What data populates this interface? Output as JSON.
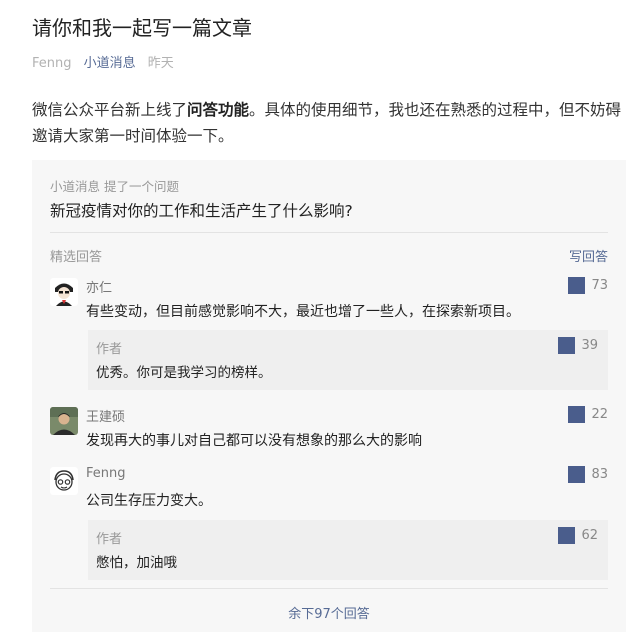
{
  "article": {
    "title": "请你和我一起写一篇文章",
    "author": "Fenng",
    "source": "小道消息",
    "time": "昨天",
    "intro_before": "微信公众平台新上线了",
    "intro_bold": "问答功能",
    "intro_after": "。具体的使用细节，我也还在熟悉的过程中，但不妨碍邀请大家第一时间体验一下。"
  },
  "qa": {
    "asker": "小道消息",
    "ask_action": "提了一个问题",
    "question": "新冠疫情对你的工作和生活产生了什么影响?",
    "featured_label": "精选回答",
    "write_label": "写回答",
    "answers": [
      {
        "name": "亦仁",
        "text": "有些变动，但目前感觉影响不大，最近也增了一些人，在探索新项目。",
        "likes": "73",
        "reply": {
          "name": "作者",
          "text": "优秀。你可是我学习的榜样。",
          "likes": "39"
        }
      },
      {
        "name": "王建硕",
        "text": "发现再大的事儿对自己都可以没有想象的那么大的影响",
        "likes": "22"
      },
      {
        "name": "Fenng",
        "text": "公司生存压力变大。",
        "likes": "83",
        "reply": {
          "name": "作者",
          "text": "憋怕，加油哦",
          "likes": "62"
        }
      }
    ],
    "more_label": "余下97个回答"
  },
  "colors": {
    "link": "#576b95",
    "like_icon": "#4a5d8c",
    "card_bg": "#f7f7f7",
    "reply_bg": "#efefef"
  },
  "icons": {
    "like": "like-square-icon"
  }
}
